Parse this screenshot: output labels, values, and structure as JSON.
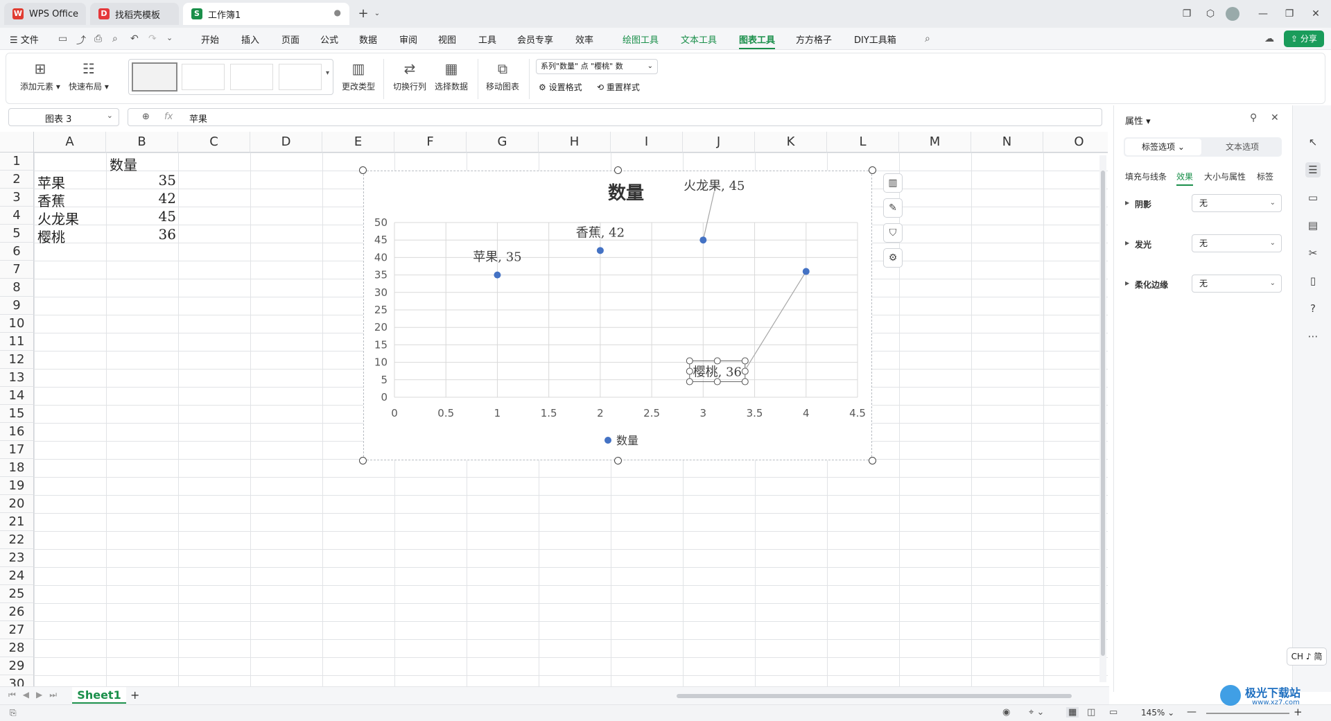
{
  "tabs": [
    {
      "label": "WPS Office",
      "logo": "W"
    },
    {
      "label": "找稻壳模板",
      "logo": "D"
    },
    {
      "label": "工作簿1",
      "logo": "S"
    }
  ],
  "menu": {
    "file": "文件",
    "items": [
      "开始",
      "插入",
      "页面",
      "公式",
      "数据",
      "审阅",
      "视图",
      "工具",
      "会员专享",
      "效率"
    ],
    "context_items": [
      "绘图工具",
      "文本工具",
      "图表工具"
    ],
    "extra_items": [
      "方方格子",
      "DIY工具箱"
    ],
    "share": "分享"
  },
  "ribbon": {
    "add_element": "添加元素",
    "quick_layout": "快速布局",
    "change_type": "更改类型",
    "switch_rowcol": "切换行列",
    "select_data": "选择数据",
    "move_chart": "移动图表",
    "element_select": "系列\"数量\" 点 \"樱桃\" 数",
    "set_format": "设置格式",
    "reset_style": "重置样式"
  },
  "formula_bar": {
    "name_box": "图表 3",
    "fx": "fx",
    "value": "苹果"
  },
  "columns": [
    "A",
    "B",
    "C",
    "D",
    "E",
    "F",
    "G",
    "H",
    "I",
    "J",
    "K",
    "L",
    "M",
    "N",
    "O"
  ],
  "rows": [
    "1",
    "2",
    "3",
    "4",
    "5",
    "6",
    "7",
    "8",
    "9",
    "10",
    "11",
    "12",
    "13",
    "14",
    "15",
    "16",
    "17",
    "18",
    "19",
    "20",
    "21",
    "22",
    "23",
    "24",
    "25",
    "26",
    "27",
    "28",
    "29",
    "30"
  ],
  "cells": {
    "b1": "数量",
    "a2": "苹果",
    "b2": "35",
    "a3": "香蕉",
    "b3": "42",
    "a4": "火龙果",
    "b4": "45",
    "a5": "樱桃",
    "b5": "36"
  },
  "chart_data": {
    "type": "scatter",
    "title": "数量",
    "xlim": [
      0,
      4.5
    ],
    "ylim": [
      0,
      50
    ],
    "x_ticks": [
      "0",
      "0.5",
      "1",
      "1.5",
      "2",
      "2.5",
      "3",
      "3.5",
      "4",
      "4.5"
    ],
    "y_ticks": [
      "0",
      "5",
      "10",
      "15",
      "20",
      "25",
      "30",
      "35",
      "40",
      "45",
      "50"
    ],
    "grid": true,
    "legend": "bottom",
    "series": [
      {
        "name": "数量",
        "color": "#4472c4",
        "points": [
          {
            "x": 1,
            "y": 35,
            "label": "苹果, 35"
          },
          {
            "x": 2,
            "y": 42,
            "label": "香蕉, 42"
          },
          {
            "x": 3,
            "y": 45,
            "label": "火龙果, 45"
          },
          {
            "x": 4,
            "y": 36,
            "label": "樱桃, 36"
          }
        ]
      }
    ]
  },
  "panel": {
    "title": "属性",
    "tab_label": "标签选项",
    "tab_text": "文本选项",
    "subtabs": [
      "填充与线条",
      "效果",
      "大小与属性",
      "标签"
    ],
    "shadow": "阴影",
    "glow": "发光",
    "soft_edge": "柔化边缘",
    "none": "无"
  },
  "ime": "CH ♪ 简",
  "sheet_tab": "Sheet1",
  "zoom": "145%",
  "watermark": "极光下载站",
  "watermark_url": "www.xz7.com"
}
